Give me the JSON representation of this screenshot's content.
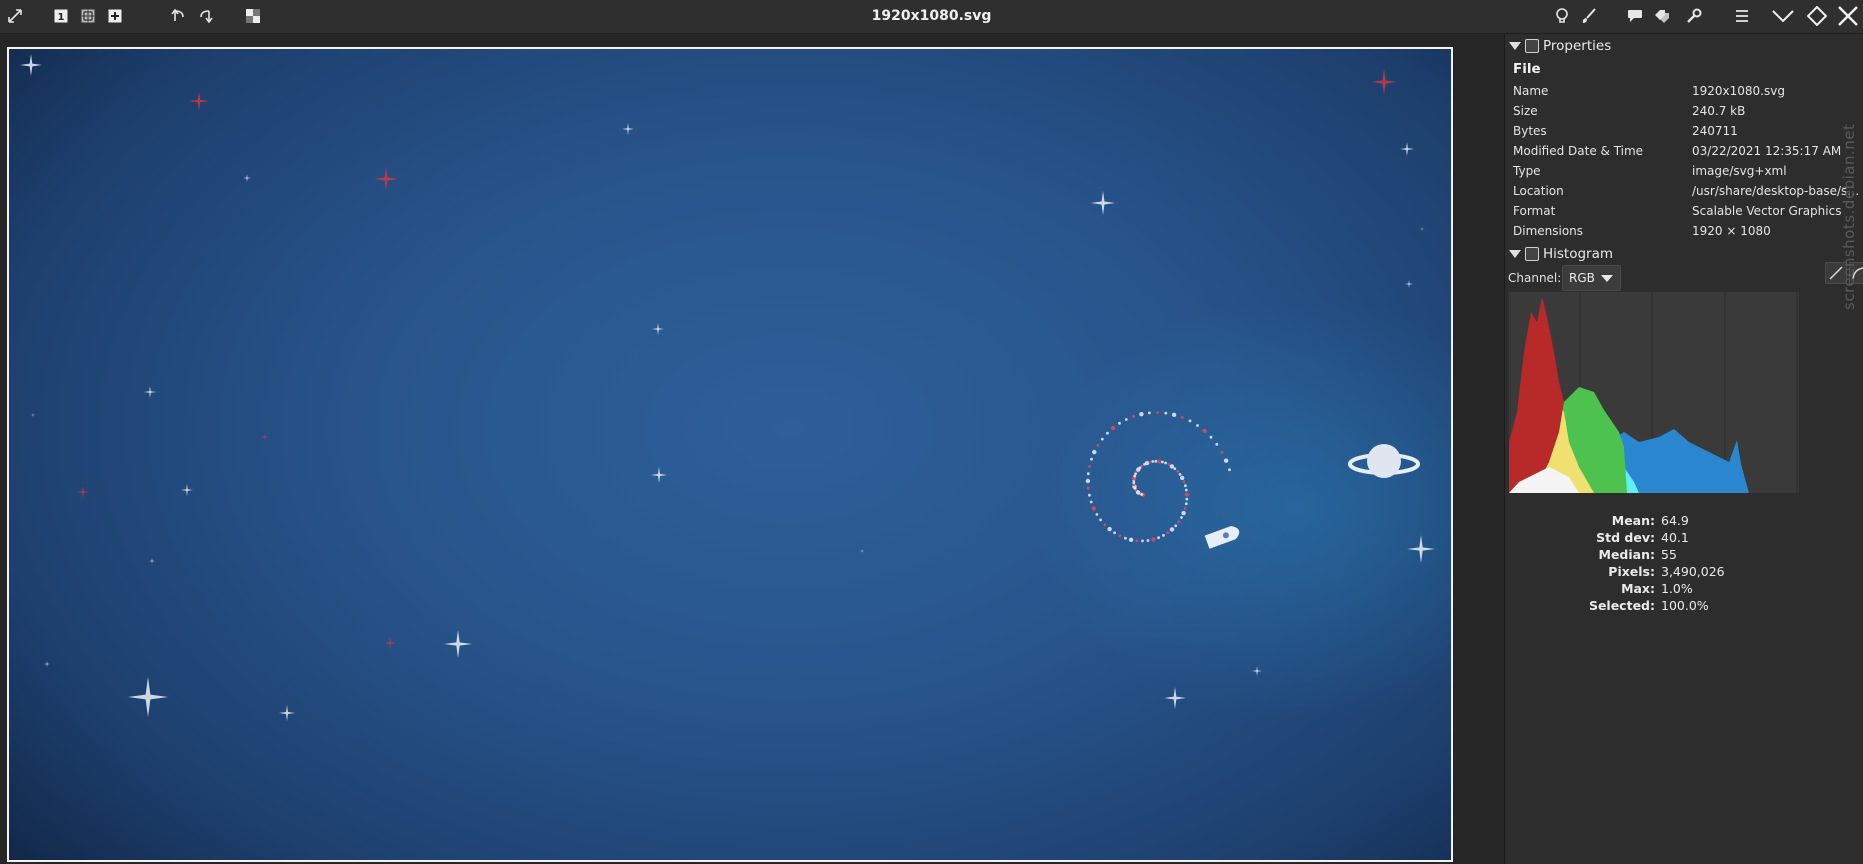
{
  "window": {
    "title": "1920x1080.svg"
  },
  "toolbar": {
    "left_icons": [
      "fullscreen-icon",
      "zoom-1-to-1-icon",
      "zoom-fit-icon",
      "zoom-fill-icon",
      "rotate-left-icon",
      "rotate-right-icon",
      "transparency-icon"
    ],
    "right_icons": [
      "lightbulb-icon",
      "brush-icon",
      "comment-icon",
      "tags-icon",
      "wrench-icon",
      "hamburger-menu-icon",
      "chevron-down-icon",
      "diamond-icon",
      "close-icon"
    ]
  },
  "panel": {
    "properties": {
      "header": "Properties",
      "file_heading": "File",
      "rows": [
        {
          "label": "Name",
          "value": "1920x1080.svg"
        },
        {
          "label": "Size",
          "value": "240.7  kB"
        },
        {
          "label": "Bytes",
          "value": "240711"
        },
        {
          "label": "Modified Date & Time",
          "value": "03/22/2021 12:35:17 AM"
        },
        {
          "label": "Type",
          "value": "image/svg+xml"
        },
        {
          "label": "Location",
          "value": "/usr/share/desktop-base/sp..."
        },
        {
          "label": "Format",
          "value": "Scalable Vector Graphics"
        },
        {
          "label": "Dimensions",
          "value": "1920 × 1080"
        }
      ]
    },
    "histogram": {
      "header": "Histogram",
      "channel_label": "Channel:",
      "channel_value": "RGB",
      "stats": [
        {
          "label": "Mean:",
          "value": "64.9"
        },
        {
          "label": "Std dev:",
          "value": "40.1"
        },
        {
          "label": "Median:",
          "value": "55"
        },
        {
          "label": "Pixels:",
          "value": "3,490,026"
        },
        {
          "label": "Max:",
          "value": "1.0%"
        },
        {
          "label": "Selected:",
          "value": "100.0%"
        }
      ]
    }
  },
  "watermark": "screenshots.debian.net",
  "colors": {
    "toolbar_bg": "#2f2f2f",
    "panel_bg": "#2d2d2d",
    "hist_red": "#b82a2a",
    "hist_yellow": "#f0e070",
    "hist_green": "#4ec24e",
    "hist_cyan": "#5ef0f4",
    "hist_blue": "#2a86cf"
  }
}
